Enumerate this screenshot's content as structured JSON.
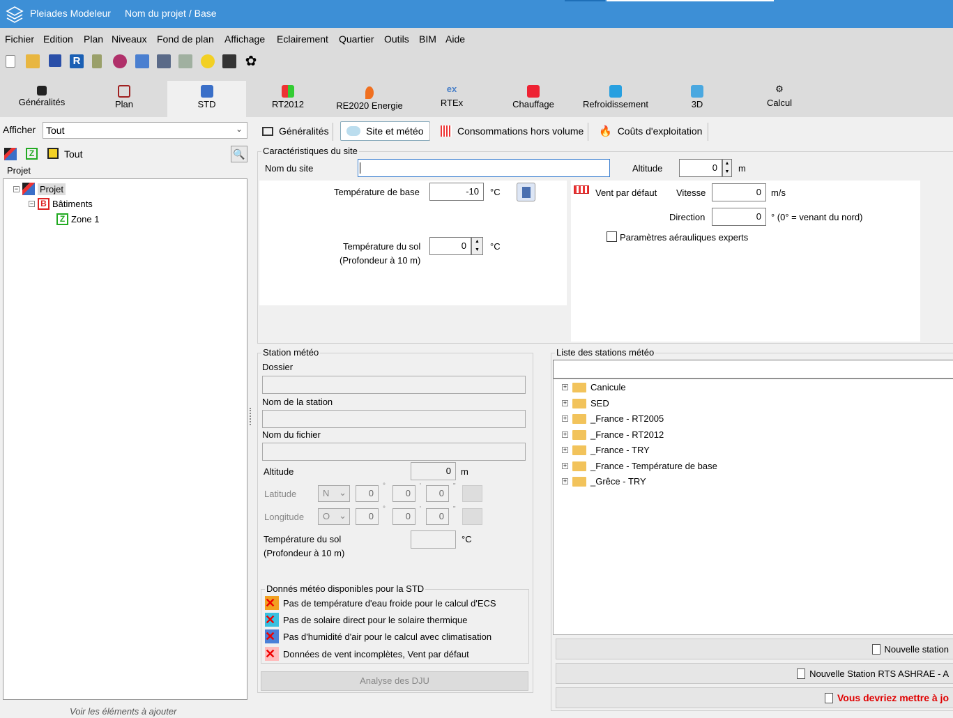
{
  "window": {
    "app_name": "Pleiades Modeleur",
    "project_title": "Nom du projet / Base"
  },
  "menu": [
    "Fichier",
    "Edition",
    "Plan",
    "Niveaux",
    "Fond de plan",
    "Affichage",
    "Eclairement",
    "Quartier",
    "Outils",
    "BIM",
    "Aide"
  ],
  "toolbar_icons": [
    "new-file-icon",
    "open-folder-icon",
    "save-icon",
    "revit-icon",
    "tool-icon",
    "network-icon",
    "table-icon",
    "list-icon",
    "link-icon",
    "sun-icon",
    "print-icon",
    "settings-icon"
  ],
  "ribbon": {
    "tabs": [
      {
        "label": "Généralités",
        "icon": "home-icon"
      },
      {
        "label": "Plan",
        "icon": "plan-icon"
      },
      {
        "label": "STD",
        "icon": "std-icon"
      },
      {
        "label": "RT2012",
        "icon": "rt2012-icon"
      },
      {
        "label": "RE2020 Energie",
        "icon": "flame-icon"
      },
      {
        "label": "RTEx",
        "icon": "rtex-icon"
      },
      {
        "label": "Chauffage",
        "icon": "heating-icon"
      },
      {
        "label": "Refroidissement",
        "icon": "cooling-icon"
      },
      {
        "label": "3D",
        "icon": "cube-icon"
      },
      {
        "label": "Calcul",
        "icon": "gears-icon"
      }
    ],
    "active": "STD"
  },
  "left_panel": {
    "afficher_label": "Afficher",
    "afficher_value": "Tout",
    "filter_label": "Tout",
    "projet_header": "Projet",
    "tree": {
      "project": "Projet",
      "buildings": "Bâtiments",
      "zone": "Zone 1",
      "building_letter": "B",
      "zone_letter": "Z"
    },
    "footer": "Voir les éléments à ajouter"
  },
  "subtabs": [
    "Généralités",
    "Site et météo",
    "Consommations hors volume",
    "Coûts d'exploitation"
  ],
  "site": {
    "legend": "Caractéristiques du site",
    "nom_label": "Nom du site",
    "nom_value": "",
    "altitude_label": "Altitude",
    "altitude_value": "0",
    "altitude_unit": "m",
    "temp_base_label": "Température de base",
    "temp_base_value": "-10",
    "temp_unit": "°C",
    "temp_sol_label": "Température du sol",
    "temp_sol_sub": "(Profondeur à 10 m)",
    "temp_sol_value": "0",
    "vent_label": "Vent par défaut",
    "vitesse_label": "Vitesse",
    "vitesse_value": "0",
    "vitesse_unit": "m/s",
    "direction_label": "Direction",
    "direction_value": "0",
    "direction_unit": "° (0° = venant du nord)",
    "experts_label": "Paramètres aérauliques experts"
  },
  "station": {
    "legend": "Station météo",
    "dossier_label": "Dossier",
    "nom_station_label": "Nom de la station",
    "nom_fichier_label": "Nom du fichier",
    "altitude_label": "Altitude",
    "altitude_value": "0",
    "altitude_unit": "m",
    "latitude_label": "Latitude",
    "latitude_dir": "N",
    "longitude_label": "Longitude",
    "longitude_dir": "O",
    "zero": "0",
    "deg": "°",
    "min": "'",
    "sec": "\"",
    "temp_sol_label": "Température du sol",
    "temp_sol_sub": "(Profondeur à 10 m)",
    "temp_unit": "°C",
    "dispo_legend": "Donnés météo disponibles pour la STD",
    "warnings": [
      "Pas de température d'eau froide pour le calcul d'ECS",
      "Pas de solaire direct pour le solaire thermique",
      "Pas d'humidité d'air pour le calcul avec climatisation",
      "Données de vent incomplètes, Vent par défaut"
    ],
    "dju_button": "Analyse des DJU"
  },
  "stations_list": {
    "legend": "Liste des stations météo",
    "search_value": "",
    "items": [
      "Canicule",
      "SED",
      "_France - RT2005",
      "_France - RT2012",
      "_France - TRY",
      "_France - Température de base",
      "_Grêce - TRY"
    ],
    "btn_new_station": "Nouvelle station",
    "btn_new_rts": "Nouvelle Station RTS ASHRAE - A",
    "btn_update": "Vous devriez mettre à jo"
  },
  "colors": {
    "titlebar": "#3d8fd6",
    "warning_text": "#e00000"
  }
}
